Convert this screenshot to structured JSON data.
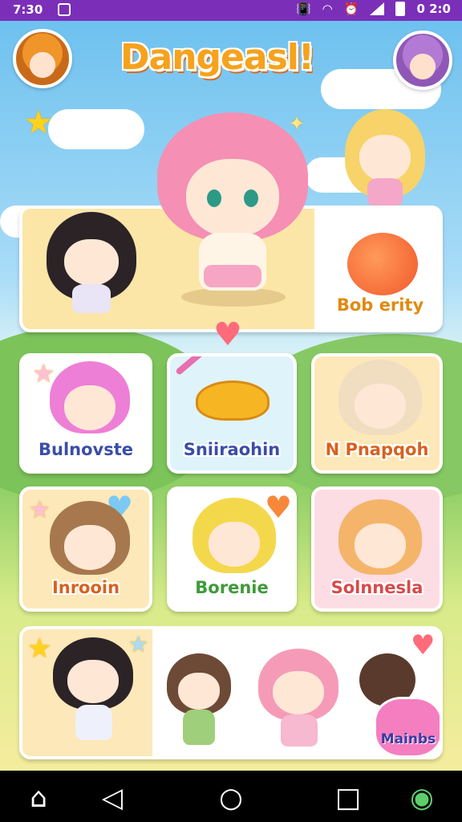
{
  "status_bar": {
    "time": "7:30",
    "right_time": "0 2:0",
    "icons": [
      "notification-icon",
      "vibrate-icon",
      "wifi-icon",
      "alarm-icon",
      "signal-icon",
      "battery-icon"
    ]
  },
  "header": {
    "title": "Dangeasl!",
    "left_avatar": "orange-hair-avatar",
    "right_avatar": "purple-hair-avatar"
  },
  "featured": {
    "label": "Bob erity",
    "item_icon": "peach-fruit-icon"
  },
  "grid": [
    {
      "label": "Bulnovste",
      "bg": "#ffffff"
    },
    {
      "label": "Sniiraohin",
      "bg": "#dff3fb"
    },
    {
      "label": "N Pnapqoh",
      "bg": "#fde8b9"
    },
    {
      "label": "Inrooin",
      "bg": "#fde8b9"
    },
    {
      "label": "Borenie",
      "bg": "#ffffff"
    },
    {
      "label": "Solnnesla",
      "bg": "#fddde4"
    }
  ],
  "bottom_row": {
    "badge_label": "Mainbs"
  },
  "nav": [
    "home-icon",
    "back-icon",
    "home-circle-icon",
    "recents-icon",
    "game-controller-icon"
  ],
  "colors": {
    "status_bar": "#7b2fb8",
    "title": "#f6a21c",
    "label": "#3a4da8",
    "badge": "#f47ec0"
  }
}
